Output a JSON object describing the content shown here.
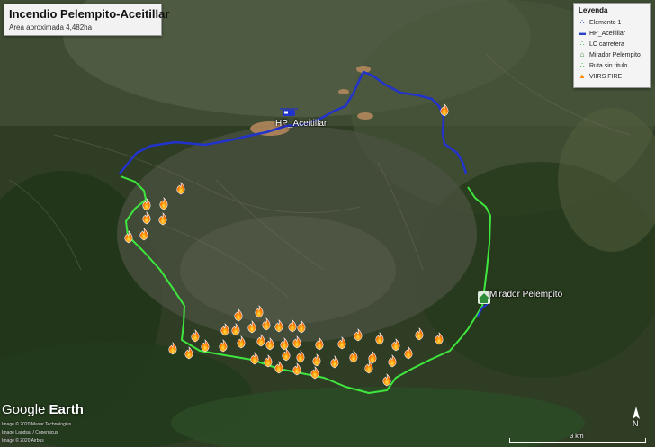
{
  "title": "Incendio Pelempito-Aceitillar",
  "subtitle": "Area aproximada 4,482ha",
  "legend": {
    "title": "Leyenda",
    "items": [
      {
        "label": "Elemento 1",
        "icon": "path-blue-icon",
        "color": "#2a3fc9"
      },
      {
        "label": "HP_Aceitillar",
        "icon": "helipad-icon",
        "color": "#2a3fc9"
      },
      {
        "label": "LC carretera",
        "icon": "path-green-icon",
        "color": "#2fb52f"
      },
      {
        "label": "Mirador Pelempito",
        "icon": "house-icon",
        "color": "#2e8b3a"
      },
      {
        "label": "Ruta sin titulo",
        "icon": "path-green-icon",
        "color": "#2fb52f"
      },
      {
        "label": "VIIRS FIRE",
        "icon": "fire-icon",
        "color": "#ff8a00"
      }
    ]
  },
  "places": {
    "helipad": "HP_Aceitillar",
    "mirador": "Mirador Pelempito"
  },
  "watermark": {
    "brand": "Google",
    "product": "Earth",
    "credits": [
      "Image © 2020 Maxar Technologies",
      "Image Landsat / Copernicus",
      "Image © 2020 Airbus"
    ]
  },
  "scale_label": "3 km",
  "north_label": "N",
  "colors": {
    "road_blue": "#2233cc",
    "route_green": "#3ee63e",
    "fire": "#ff7a00"
  }
}
